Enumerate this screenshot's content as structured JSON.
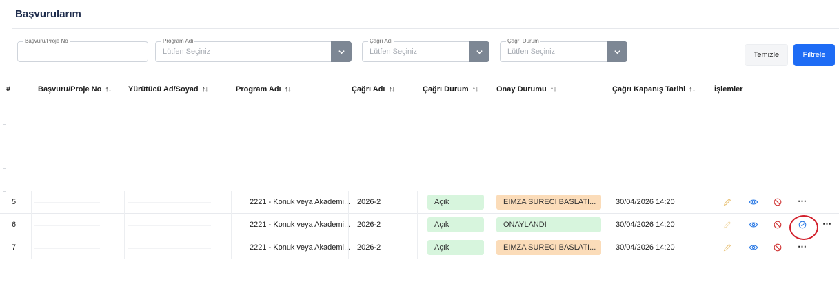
{
  "page": {
    "title": "Başvurularım"
  },
  "filters": {
    "app_no": {
      "label": "Başvuru/Proje No",
      "placeholder": ""
    },
    "program": {
      "label": "Program Adı",
      "placeholder": "Lütfen Seçiniz"
    },
    "call": {
      "label": "Çağrı Adı",
      "placeholder": "Lütfen Seçiniz"
    },
    "call_status": {
      "label": "Çağrı Durum",
      "placeholder": "Lütfen Seçiniz"
    },
    "clear_label": "Temizle",
    "filter_label": "Filtrele"
  },
  "table": {
    "columns": {
      "index": "#",
      "app_no": "Başvuru/Proje No",
      "executor": "Yürütücü Ad/Soyad",
      "program": "Program Adı",
      "call": "Çağrı Adı",
      "call_status": "Çağrı Durum",
      "approval": "Onay Durumu",
      "close_date": "Çağrı Kapanış Tarihi",
      "actions": "İşlemler"
    },
    "sort_glyph": "↑↓",
    "rows": [
      {
        "index": "5",
        "program": "2221 - Konuk veya Akademi...",
        "call": "2026-2",
        "call_status": "Açık",
        "approval": "EIMZA SURECI BASLATI...",
        "approval_color": "#fbdcb9",
        "close_date": "30/04/2026 14:20"
      },
      {
        "index": "6",
        "program": "2221 - Konuk veya Akademi...",
        "call": "2026-2",
        "call_status": "Açık",
        "approval": "ONAYLANDI",
        "approval_color": "#d7f5dd",
        "close_date": "30/04/2026 14:20"
      },
      {
        "index": "7",
        "program": "2221 - Konuk veya Akademi...",
        "call": "2026-2",
        "call_status": "Açık",
        "approval": "EIMZA SURECI BASLATI...",
        "approval_color": "#fbdcb9",
        "close_date": "30/04/2026 14:20"
      }
    ],
    "more_glyph": "⋯"
  },
  "icons": {
    "edit": "pencil-icon",
    "view": "eye-icon",
    "cancel": "ban-icon",
    "approve": "check-circle-icon",
    "more": "more-horizontal-icon",
    "dropdown": "chevron-down-icon"
  },
  "colors": {
    "primary": "#1e6cf5",
    "status_open": "#d7f5dd",
    "status_pending": "#fbdcb9",
    "edit_icon": "#e9c37a",
    "view_icon": "#2d7be5",
    "cancel_icon": "#d23b3b",
    "highlight": "#d21f2b"
  }
}
